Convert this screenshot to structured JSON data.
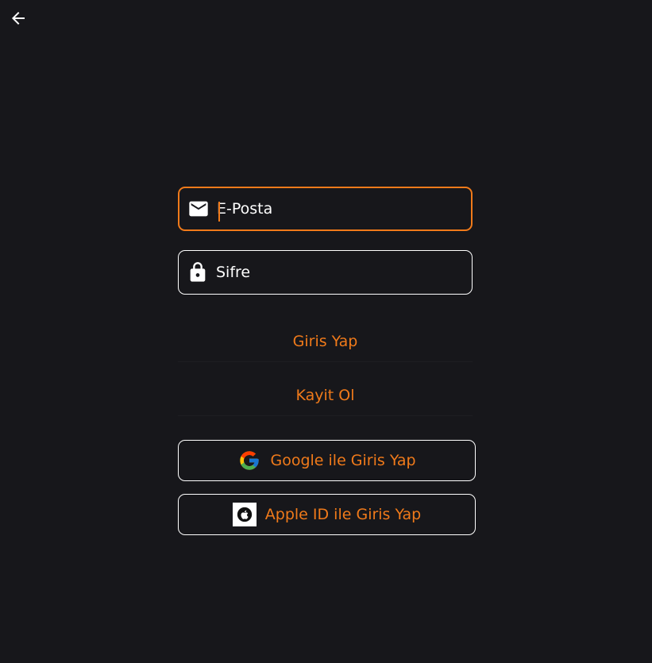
{
  "nav": {
    "back_icon": "arrow-left-icon"
  },
  "form": {
    "email": {
      "placeholder": "E-Posta",
      "value": "",
      "icon": "mail-icon",
      "focused": true
    },
    "password": {
      "placeholder": "Sifre",
      "value": "",
      "icon": "lock-icon"
    }
  },
  "actions": {
    "login_label": "Giris Yap",
    "register_label": "Kayit Ol",
    "google_label": "Google ile Giris Yap",
    "apple_label": "Apple ID ile Giris Yap"
  },
  "colors": {
    "background": "#17171b",
    "accent": "#f07a1a",
    "border": "#ffffff",
    "text": "#ffffff"
  }
}
